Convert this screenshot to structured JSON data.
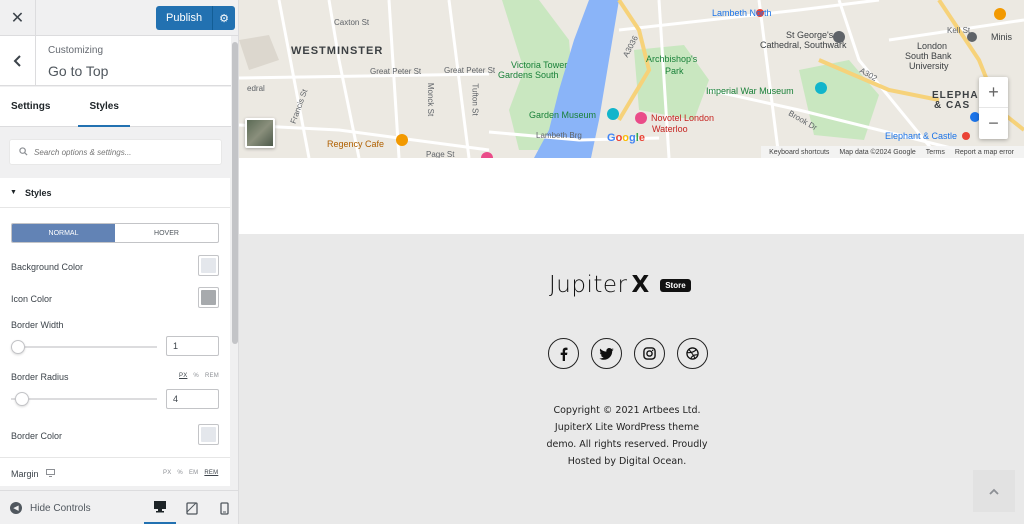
{
  "topbar": {
    "close_icon": "close-icon",
    "publish_label": "Publish",
    "settings_icon": "gear-icon"
  },
  "header": {
    "breadcrumb": "Customizing",
    "title": "Go to Top"
  },
  "tabs": [
    {
      "label": "Settings",
      "active": false
    },
    {
      "label": "Styles",
      "active": true
    }
  ],
  "search": {
    "placeholder": "Search options & settings..."
  },
  "styles_section": {
    "heading": "Styles",
    "state_toggle": [
      "NORMAL",
      "HOVER"
    ],
    "active_state": "NORMAL",
    "background_color": {
      "label": "Background Color",
      "value": "#e4e7ec"
    },
    "icon_color": {
      "label": "Icon Color",
      "value": "#a7aaad"
    },
    "border_width": {
      "label": "Border Width",
      "value": "1"
    },
    "border_radius": {
      "label": "Border Radius",
      "value": "4",
      "units": [
        "PX",
        "%",
        "REM"
      ],
      "selected_unit": "PX"
    },
    "border_color": {
      "label": "Border Color",
      "value": "#e4e7ec"
    },
    "margin": {
      "label": "Margin",
      "units": [
        "PX",
        "%",
        "EM",
        "REM"
      ],
      "selected_unit": "REM"
    }
  },
  "footer_controls": {
    "hide_label": "Hide Controls",
    "devices": [
      "desktop",
      "tablet",
      "mobile"
    ]
  },
  "map": {
    "labels": {
      "westminster": "WESTMINSTER",
      "caxton": "Caxton St",
      "great_peter_1": "Great Peter St",
      "great_peter_2": "Great Peter St",
      "victoria_tower": "Victoria Tower",
      "gardens_south": "Gardens South",
      "archbishops": "Archbishop's",
      "park": "Park",
      "lambeth_north": "Lambeth North",
      "st_georges": "St George's",
      "cathedral": "Cathedral, Southwark",
      "london": "London",
      "south_bank": "South Bank",
      "university": "University",
      "imperial": "Imperial War Museum",
      "garden_museum": "Garden Museum",
      "novotel": "Novotel London",
      "waterloo": "Waterloo",
      "lambeth_brg": "Lambeth Brg",
      "regency": "Regency Cafe",
      "elephant_castle": "Elephant & Castle",
      "elephant_area": "ELEPHANT",
      "castle_area": "& CAS",
      "a3036": "A3036",
      "a302": "A302",
      "ed": "edral",
      "page_st": "Page St",
      "monck": "Monck St",
      "tufton": "Tufton St",
      "francis": "Francis St",
      "brook": "Brook Dr",
      "kell": "Kell St",
      "minis": "Minis",
      "google": "Google"
    },
    "attribution": [
      "Keyboard shortcuts",
      "Map data ©2024 Google",
      "Terms",
      "Report a map error"
    ],
    "zoom_in": "+",
    "zoom_out": "−"
  },
  "site_footer": {
    "brand": "Jupiter",
    "brand_x": "X",
    "badge": "Store",
    "socials": [
      "facebook-icon",
      "twitter-icon",
      "instagram-icon",
      "dribbble-icon"
    ],
    "copyright_lines": [
      "Copyright © 2021 Artbees Ltd.",
      "JupiterX Lite WordPress theme",
      "demo. All rights reserved. Proudly",
      "Hosted by Digital Ocean."
    ],
    "to_top_icon": "chevron-up-icon"
  },
  "colors": {
    "accent": "#2271b1",
    "toggle_active": "#6283b5"
  }
}
